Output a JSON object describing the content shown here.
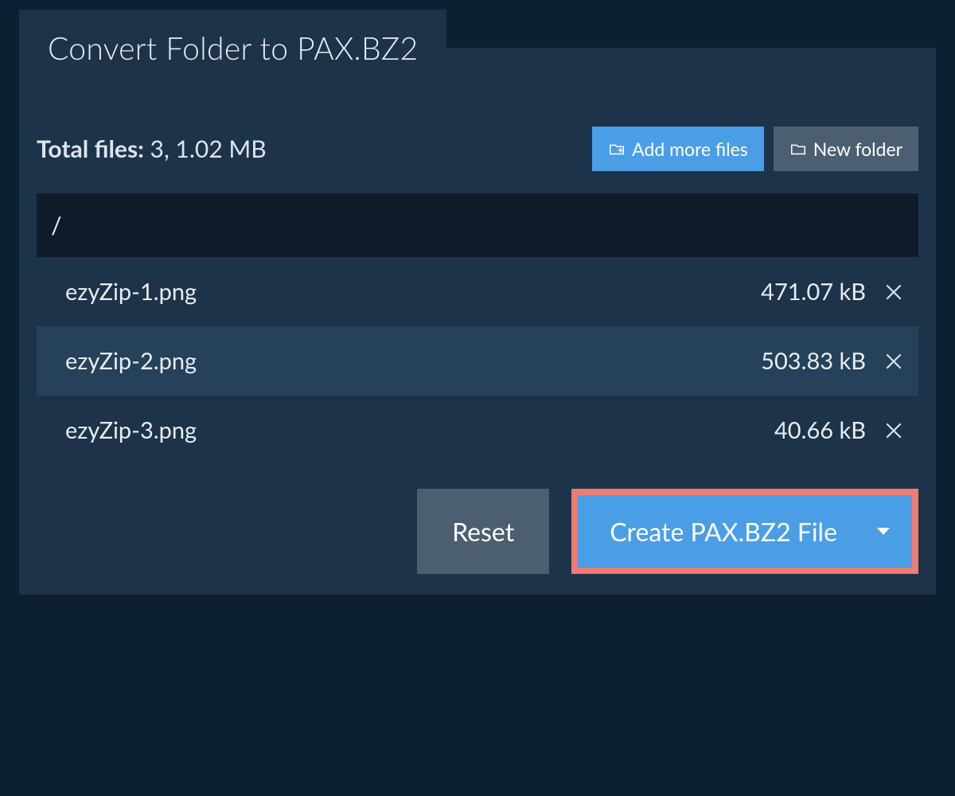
{
  "tab": {
    "title": "Convert Folder to PAX.BZ2"
  },
  "summary": {
    "label": "Total files:",
    "value": "3, 1.02 MB"
  },
  "buttons": {
    "add_more": "Add more files",
    "new_folder": "New folder",
    "reset": "Reset",
    "create": "Create PAX.BZ2 File"
  },
  "path": "/",
  "files": [
    {
      "name": "ezyZip-1.png",
      "size": "471.07 kB"
    },
    {
      "name": "ezyZip-2.png",
      "size": "503.83 kB"
    },
    {
      "name": "ezyZip-3.png",
      "size": "40.66 kB"
    }
  ]
}
